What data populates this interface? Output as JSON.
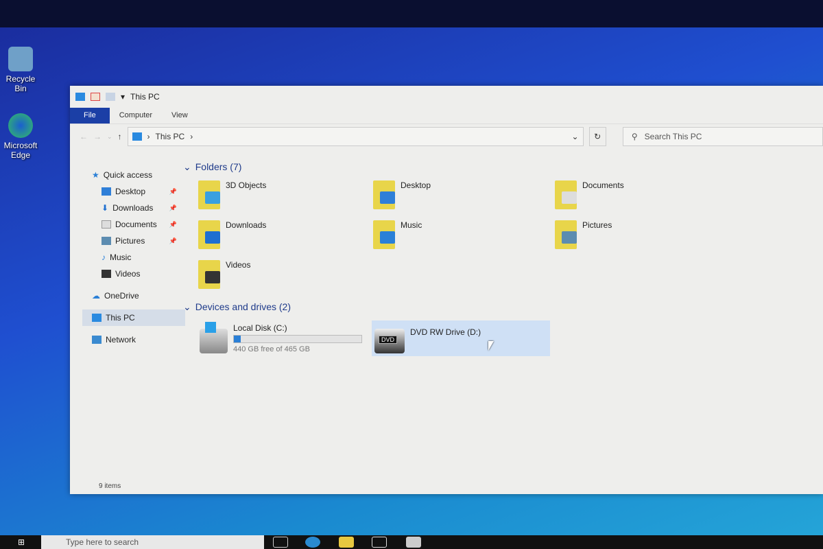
{
  "desktop": {
    "icons": [
      {
        "label": "Recycle Bin"
      },
      {
        "label": "Microsoft Edge"
      }
    ]
  },
  "window": {
    "title": "This PC",
    "ribbon_tabs": [
      "File",
      "Computer",
      "View"
    ],
    "address": {
      "crumbs": [
        "This PC"
      ],
      "search_placeholder": "Search This PC"
    },
    "nav": {
      "quick_access": "Quick access",
      "quick_items": [
        {
          "label": "Desktop"
        },
        {
          "label": "Downloads"
        },
        {
          "label": "Documents"
        },
        {
          "label": "Pictures"
        },
        {
          "label": "Music"
        },
        {
          "label": "Videos"
        }
      ],
      "onedrive": "OneDrive",
      "this_pc": "This PC",
      "network": "Network"
    },
    "folders_header": "Folders (7)",
    "folders": [
      {
        "label": "3D Objects",
        "color": "#3aa0e0"
      },
      {
        "label": "Desktop",
        "color": "#2f7fd8"
      },
      {
        "label": "Documents",
        "color": "#dddddd"
      },
      {
        "label": "Downloads",
        "color": "#1e6fd0"
      },
      {
        "label": "Music",
        "color": "#2a80d8"
      },
      {
        "label": "Pictures",
        "color": "#5c8cb0"
      },
      {
        "label": "Videos",
        "color": "#333333"
      }
    ],
    "devices_header": "Devices and drives (2)",
    "drives": [
      {
        "label": "Local Disk (C:)",
        "free": "440 GB free of 465 GB",
        "used_fraction": 0.054
      },
      {
        "label": "DVD RW Drive (D:)",
        "badge": "DVD"
      }
    ],
    "status": "9 items"
  },
  "taskbar": {
    "search_placeholder": "Type here to search"
  }
}
